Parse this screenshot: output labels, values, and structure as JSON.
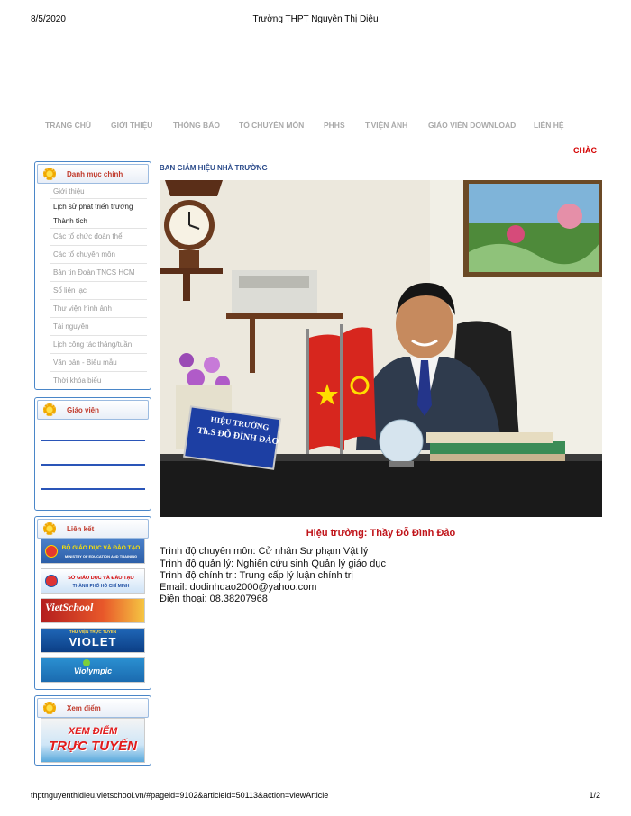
{
  "print": {
    "date": "8/5/2020",
    "title": "Trường THPT Nguyễn Thị Diệu",
    "url": "thptnguyenthidieu.vietschool.vn/#pageid=9102&articleid=50113&action=viewArticle",
    "page": "1/2"
  },
  "nav": [
    "TRANG CHỦ",
    "GIỚI THIỆU",
    "THÔNG BÁO",
    "TỔ CHUYÊN MÔN",
    "PHHS",
    "T.VIỆN ẢNH",
    "GIÁO VIÊN DOWNLOAD",
    "LIÊN HỆ"
  ],
  "marquee": "CHÀC",
  "sidebar": {
    "menu": {
      "title": "Danh mục chính",
      "items": [
        "Giới thiệu",
        "Lịch sử phát triển trường",
        "Thành tích",
        "Các tổ chức đoàn thể",
        "Các tổ chuyên môn",
        "Bản tin Đoàn TNCS HCM",
        "Sổ liên lạc",
        "Thư viện hình ảnh",
        "Tài nguyên",
        "Lịch công tác tháng/tuần",
        "Văn bản - Biểu mẫu",
        "Thời khóa biểu"
      ]
    },
    "teachers": {
      "title": "Giáo viên"
    },
    "links": {
      "title": "Liên kết",
      "banners": [
        {
          "text": "BỘ GIÁO DỤC VÀ ĐÀO TẠO",
          "sub": "MINISTRY OF EDUCATION AND TRAINING"
        },
        {
          "text": "SỞ GIÁO DỤC VÀ ĐÀO TẠO",
          "sub": "THÀNH PHỐ HỒ CHÍ MINH"
        },
        {
          "text": "VietSchool",
          "sub": ""
        },
        {
          "text": "VIOLET",
          "sub": "THƯ VIỆN TRỰC TUYẾN"
        },
        {
          "text": "Violympic",
          "sub": ""
        }
      ]
    },
    "scores": {
      "title": "Xem điểm",
      "banner_line1": "XEM ĐIỂM",
      "banner_line2": "TRỰC TUYẾN"
    }
  },
  "main": {
    "section_title": "BAN GIÁM HIỆU NHÀ TRƯỜNG",
    "nameplate": {
      "line1": "HIỆU TRƯỞNG",
      "line2": "Th.S ĐỖ ĐÌNH ĐẢO"
    },
    "principal": "Hiệu trưởng: Thầy Đỗ Đình Đảo",
    "info": [
      "Trình độ chuyên môn: Cử nhân Sư phạm Vật lý",
      "Trình độ quản lý: Nghiên cứu sinh Quản lý giáo dục",
      "Trình độ chính trị: Trung cấp lý luận chính trị",
      "Email: dodinhdao2000@yahoo.com",
      "Điện thoại: 08.38207968"
    ]
  }
}
